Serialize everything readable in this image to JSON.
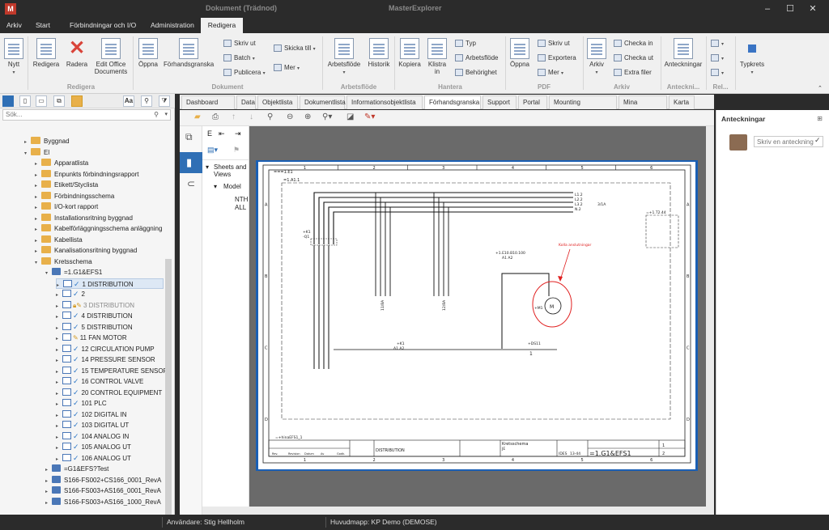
{
  "titlebar": {
    "logo": "M",
    "document_title": "Dokument (Trädnod)",
    "app_title": "MasterExplorer"
  },
  "menu_tabs": [
    "Arkiv",
    "Start",
    "Förbindningar och I/O",
    "Administration",
    "Redigera"
  ],
  "ribbon": {
    "nytt": "Nytt",
    "redigera": "Redigera",
    "radera": "Radera",
    "edit_office": "Edit Office Documents",
    "oppna": "Öppna",
    "forhandsgranska": "Förhandsgranska",
    "skriv_ut": "Skriv ut",
    "batch": "Batch",
    "publicera": "Publicera",
    "skicka_till": "Skicka till",
    "mer": "Mer",
    "arbetsflode": "Arbetsflöde",
    "historik": "Historik",
    "kopiera": "Kopiera",
    "klistra_in": "Klistra in",
    "typ": "Typ",
    "arbetsflode_small": "Arbetsflöde",
    "behorighet": "Behörighet",
    "oppna_pdf": "Öppna",
    "skriv_ut_pdf": "Skriv ut",
    "exportera": "Exportera",
    "mer_pdf": "Mer",
    "arkiv": "Arkiv",
    "checka_in": "Checka in",
    "checka_ut": "Checka ut",
    "extra_filer": "Extra filer",
    "anteckningar": "Anteckningar",
    "typkrets": "Typkrets",
    "groups": {
      "redigera": "Redigera",
      "dokument": "Dokument",
      "arbetsflode": "Arbetsflöde",
      "hantera": "Hantera",
      "pdf": "PDF",
      "arkiv": "Arkiv",
      "anteckn": "Anteckni...",
      "rel": "Rel..."
    }
  },
  "left_panel": {
    "search_placeholder": "Sök...",
    "aa_label": "Aa",
    "tree": [
      {
        "label": "Byggnad"
      },
      {
        "label": "El"
      },
      {
        "label": "Apparatlista"
      },
      {
        "label": "Enpunkts förbindningsrapport"
      },
      {
        "label": "Etikett/Styclista"
      },
      {
        "label": "Förbindningsschema"
      },
      {
        "label": "I/O-kort rapport"
      },
      {
        "label": "Installationsritning byggnad"
      },
      {
        "label": "Kabelförläggningsschema anläggning"
      },
      {
        "label": "Kabellista"
      },
      {
        "label": "Kanalisationsritning byggnad"
      },
      {
        "label": "Kretsschema"
      },
      {
        "label": "=1.G1&EFS1"
      },
      {
        "label": "1  DISTRIBUTION"
      },
      {
        "label": "2"
      },
      {
        "label": "3  DISTRIBUTION"
      },
      {
        "label": "4  DISTRIBUTION"
      },
      {
        "label": "5  DISTRIBUTION"
      },
      {
        "label": "11  FAN MOTOR"
      },
      {
        "label": "12  CIRCULATION PUMP"
      },
      {
        "label": "14  PRESSURE SENSOR"
      },
      {
        "label": "15  TEMPERATURE SENSOR"
      },
      {
        "label": "16  CONTROL VALVE"
      },
      {
        "label": "20  CONTROL EQUIPMENT"
      },
      {
        "label": "101  PLC"
      },
      {
        "label": "102  DIGITAL IN"
      },
      {
        "label": "103  DIGITAL UT"
      },
      {
        "label": "104  ANALOG IN"
      },
      {
        "label": "105  ANALOG UT"
      },
      {
        "label": "106  ANALOG UT"
      },
      {
        "label": "=G1&EFS?Test"
      },
      {
        "label": "S166-FS002+CS166_0001_RevA"
      },
      {
        "label": "S166-FS003+AS166_0001_RevA"
      },
      {
        "label": "S166-FS003+AS166_1000_RevA"
      }
    ]
  },
  "doc_tabs": [
    "Dashboard",
    "Data",
    "Objektlista",
    "Dokumentlista",
    "Informationsobjektlista",
    "Förhandsgranska",
    "Support",
    "Portal",
    "Mounting Calculation",
    "Mina uppgifter",
    "Karta"
  ],
  "bookmarks": {
    "sheets_views": "Sheets and Views",
    "model": "Model",
    "nth": "NTH",
    "all": "ALL"
  },
  "drawing": {
    "columns": [
      "1",
      "2",
      "3",
      "4",
      "5",
      "6"
    ],
    "rows": [
      "A",
      "B",
      "C",
      "D"
    ],
    "tag_top_left": "===1.E1",
    "tag_a1": "=1.A1.1",
    "tag_k1": "+K1",
    "tag_k1b": "-Q1",
    "tag_right": "=+1.T2.44",
    "l_labels": [
      "L1.2",
      "L2.2",
      "L3.2",
      "N.2"
    ],
    "ref_3a": "3/1A",
    "wire_left": "11/8A",
    "wire_mid": "12/8A",
    "tag_e10": "+1.E10.B10.100",
    "tag_a1a2": "A1  A2",
    "motor_tag": "+M1",
    "k11": "+K1",
    "k11b": "A1  A2",
    "s11": "+DS11",
    "s11num": "1",
    "annotation": "Kolla anslutningar",
    "bottom_tag": "=+hinaEFS1_1",
    "title_block": {
      "distribution": "DISTRIBUTION",
      "kretsschema": "Kretsschema",
      "je": "JE",
      "code": "=1.G1&EFS1",
      "nr": "1",
      "next": "2",
      "ides": "IDES",
      "page": "13-44"
    },
    "revision_labels": [
      "Rev.",
      "Revision",
      "Datum",
      "Av",
      "Godk."
    ]
  },
  "right_panel": {
    "title": "Anteckningar",
    "pin": "⊞",
    "note_placeholder": "Skriv en anteckning"
  },
  "statusbar": {
    "user": "Användare: Stig Hellholm",
    "main_folder": "Huvudmapp: KP Demo (DEMOSE)"
  },
  "colors": {
    "dark": "#2b2b2b",
    "ribbon": "#f0f0f0",
    "accent_blue": "#2f6fb5",
    "drawing_border": "#1a5fb4",
    "annotation_red": "#e02020"
  }
}
